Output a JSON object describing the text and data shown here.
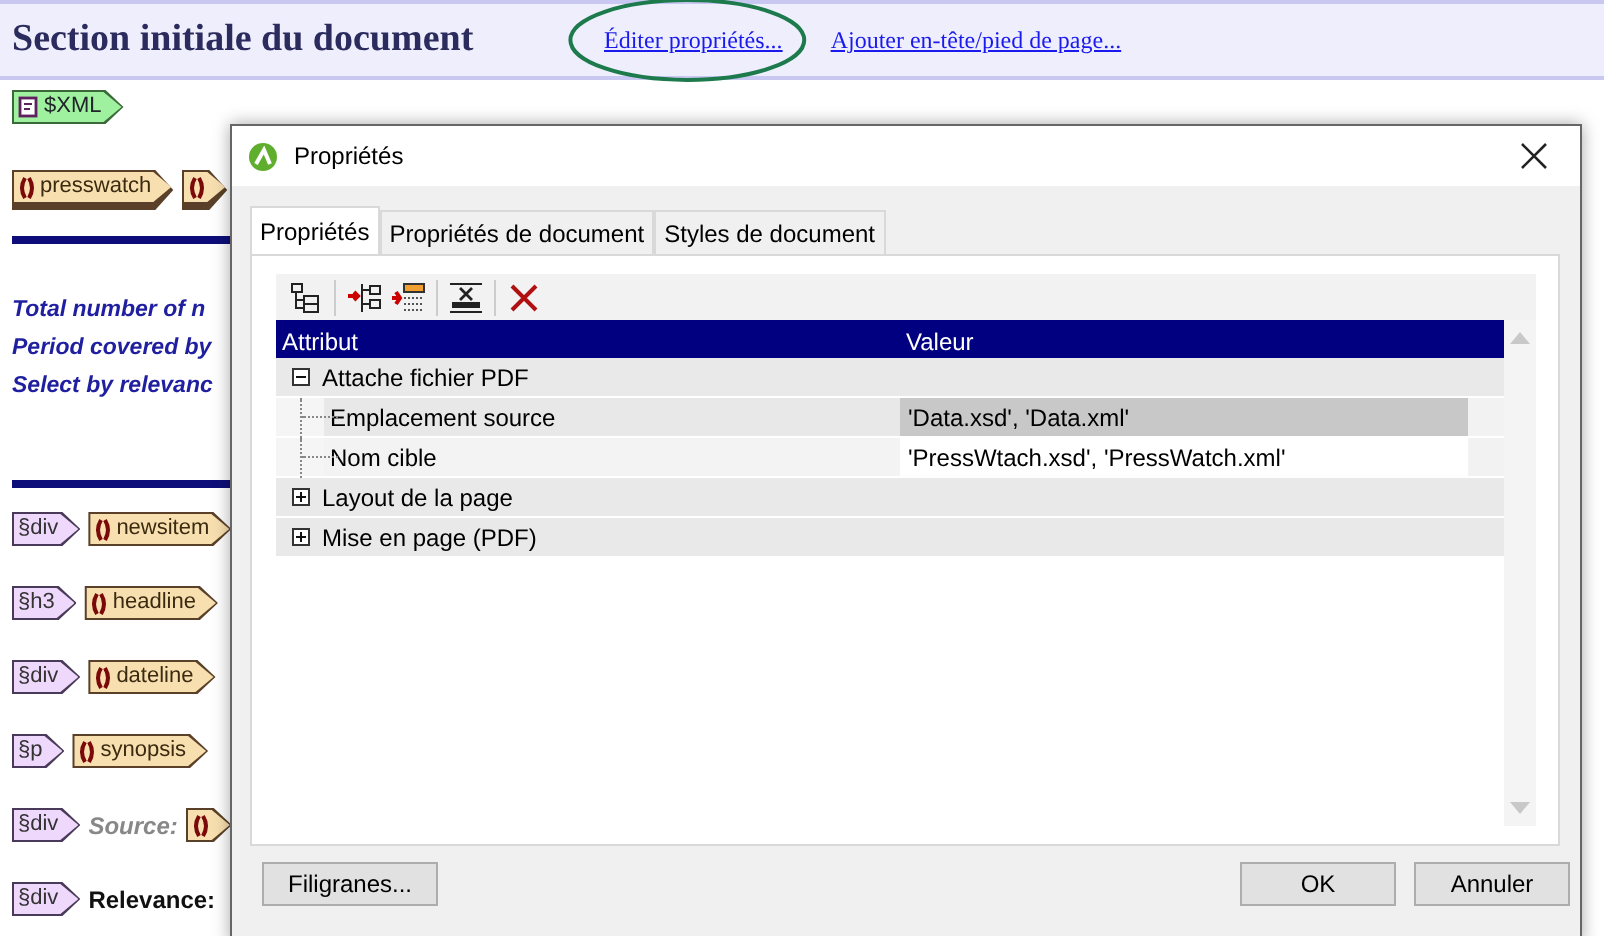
{
  "header": {
    "title": "Section initiale du document",
    "links": [
      {
        "text": "Éditer propriétés...",
        "circled": true
      },
      {
        "text": "Ajouter en-tête/pied de page...",
        "circled": false
      }
    ]
  },
  "xml_tag": {
    "label": "$XML"
  },
  "top_row": [
    {
      "kind": "template",
      "label": "presswatch"
    },
    {
      "kind": "template"
    }
  ],
  "summary_lines": [
    "Total number of n",
    "Period covered by",
    "Select by relevanc"
  ],
  "rows": [
    {
      "element": "§div",
      "items": [
        {
          "kind": "template",
          "label": "newsitem"
        }
      ]
    },
    {
      "element": "§h3",
      "items": [
        {
          "kind": "template",
          "label": "headline"
        }
      ]
    },
    {
      "element": "§div",
      "items": [
        {
          "kind": "template",
          "label": "dateline"
        }
      ]
    },
    {
      "element": "§p",
      "items": [
        {
          "kind": "template",
          "label": "synopsis"
        }
      ]
    },
    {
      "element": "§div",
      "items": [
        {
          "kind": "muted_text",
          "text": "Source:"
        },
        {
          "kind": "template"
        }
      ]
    },
    {
      "element": "§div",
      "items": [
        {
          "kind": "text",
          "text": "Relevance:"
        }
      ]
    }
  ],
  "dialog": {
    "title": "Propriétés",
    "tabs": [
      {
        "label": "Propriétés",
        "selected": true
      },
      {
        "label": "Propriétés de document",
        "selected": false
      },
      {
        "label": "Styles de document",
        "selected": false
      }
    ],
    "columns": [
      "Attribut",
      "Valeur"
    ],
    "tree": [
      {
        "label": "Attache fichier PDF",
        "expanded": true,
        "children": [
          {
            "label": "Emplacement source",
            "value": "'Data.xsd', 'Data.xml'",
            "selected": true
          },
          {
            "label": "Nom cible",
            "value": "'PressWtach.xsd', 'PressWatch.xml'",
            "selected": false
          }
        ]
      },
      {
        "label": "Layout de la page",
        "expanded": false
      },
      {
        "label": "Mise en page (PDF)",
        "expanded": false
      }
    ],
    "left_buttons": [
      "Filigranes..."
    ],
    "right_buttons": [
      "OK",
      "Annuler"
    ]
  }
}
